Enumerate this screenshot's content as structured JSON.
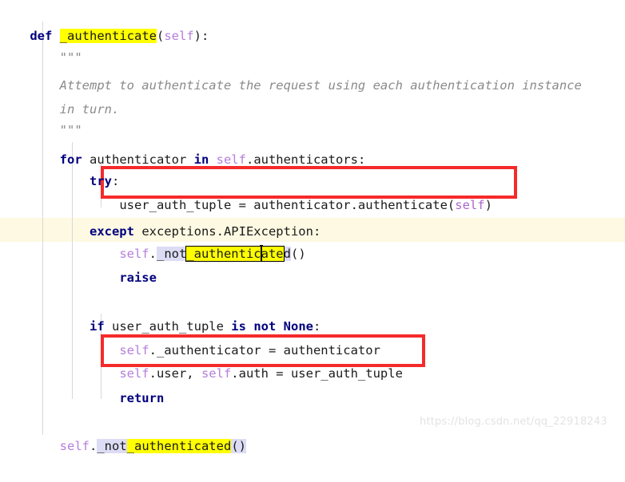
{
  "editor": {
    "language": "python",
    "colors": {
      "background": "#ffffff",
      "keyword": "#00007f",
      "self_token": "#b57edc",
      "docstring": "#8a8a8a",
      "plain_text": "#1b1b1b",
      "search_highlight": "#ffff00",
      "occurrence_highlight": "#dcdcf5",
      "current_line_band": "#fdf9e2",
      "annotation_box": "#f52a2a",
      "indent_guide": "#d8d8d8",
      "watermark": "#e3e3e3"
    }
  },
  "code": {
    "line_01": {
      "kw_def": "def",
      "space": " ",
      "name_highlighted": "_authenticate",
      "open_paren": "(",
      "arg_self": "self",
      "close_paren_colon": "):"
    },
    "line_02": {
      "indent": "    ",
      "text": "\"\"\""
    },
    "line_03": {
      "indent": "    ",
      "text": "Attempt to authenticate the request using each authentication instance"
    },
    "line_04": {
      "indent": "    ",
      "text": "in turn."
    },
    "line_05": {
      "indent": "    ",
      "text": "\"\"\""
    },
    "line_06": {
      "indent": "    ",
      "text": ""
    },
    "line_07": {
      "indent": "    ",
      "kw_for": "for",
      "var_target": " authenticator ",
      "kw_in": "in",
      "self_token": " self",
      "attr": ".authenticators:"
    },
    "line_08": {
      "indent": "        ",
      "kw_try": "try",
      "colon": ":"
    },
    "line_09": {
      "indent": "            ",
      "lhs": "user_auth_tuple = authenticator.authenticate(",
      "self_token": "self",
      "close_paren": ")"
    },
    "line_10": {
      "indent": "        ",
      "kw_except": "except",
      "rest": " exceptions.APIException:"
    },
    "line_11": {
      "indent": "            ",
      "self_token": "self",
      "dot": ".",
      "occurrence_prefix": "_not",
      "boxed_highlight_left": "_authentic",
      "boxed_highlight_right": "ate",
      "occurrence_suffix": "d",
      "call_parens": "()"
    },
    "line_12": {
      "indent": "            ",
      "kw_raise": "raise"
    },
    "line_13": {
      "indent": "",
      "text": ""
    },
    "line_14": {
      "indent": "        ",
      "kw_if": "if",
      "var": " user_auth_tuple ",
      "kw_is": "is",
      "space1": " ",
      "kw_not": "not",
      "space2": " ",
      "kw_none": "None",
      "colon": ":"
    },
    "line_15": {
      "indent": "            ",
      "self_token": "self",
      "rest": "._authenticator = authenticator"
    },
    "line_16": {
      "indent": "            ",
      "self_a": "self",
      "mid_a": ".user, ",
      "self_b": "self",
      "rest": ".auth = user_auth_tuple"
    },
    "line_17": {
      "indent": "            ",
      "kw_return": "return"
    },
    "line_18": {
      "indent": "",
      "text": ""
    },
    "line_19": {
      "indent": "    ",
      "self_token": "self",
      "dot": ".",
      "occurrence_prefix": "_not",
      "highlight": "_authenticated",
      "call_parens": "()"
    }
  },
  "annotations": {
    "box_1_label": "user_auth_tuple = authenticator.authenticate(self)",
    "box_2_label": "self.user, self.auth = user_auth_tuple"
  },
  "watermark": {
    "text": "https://blog.csdn.net/qq_22918243"
  }
}
